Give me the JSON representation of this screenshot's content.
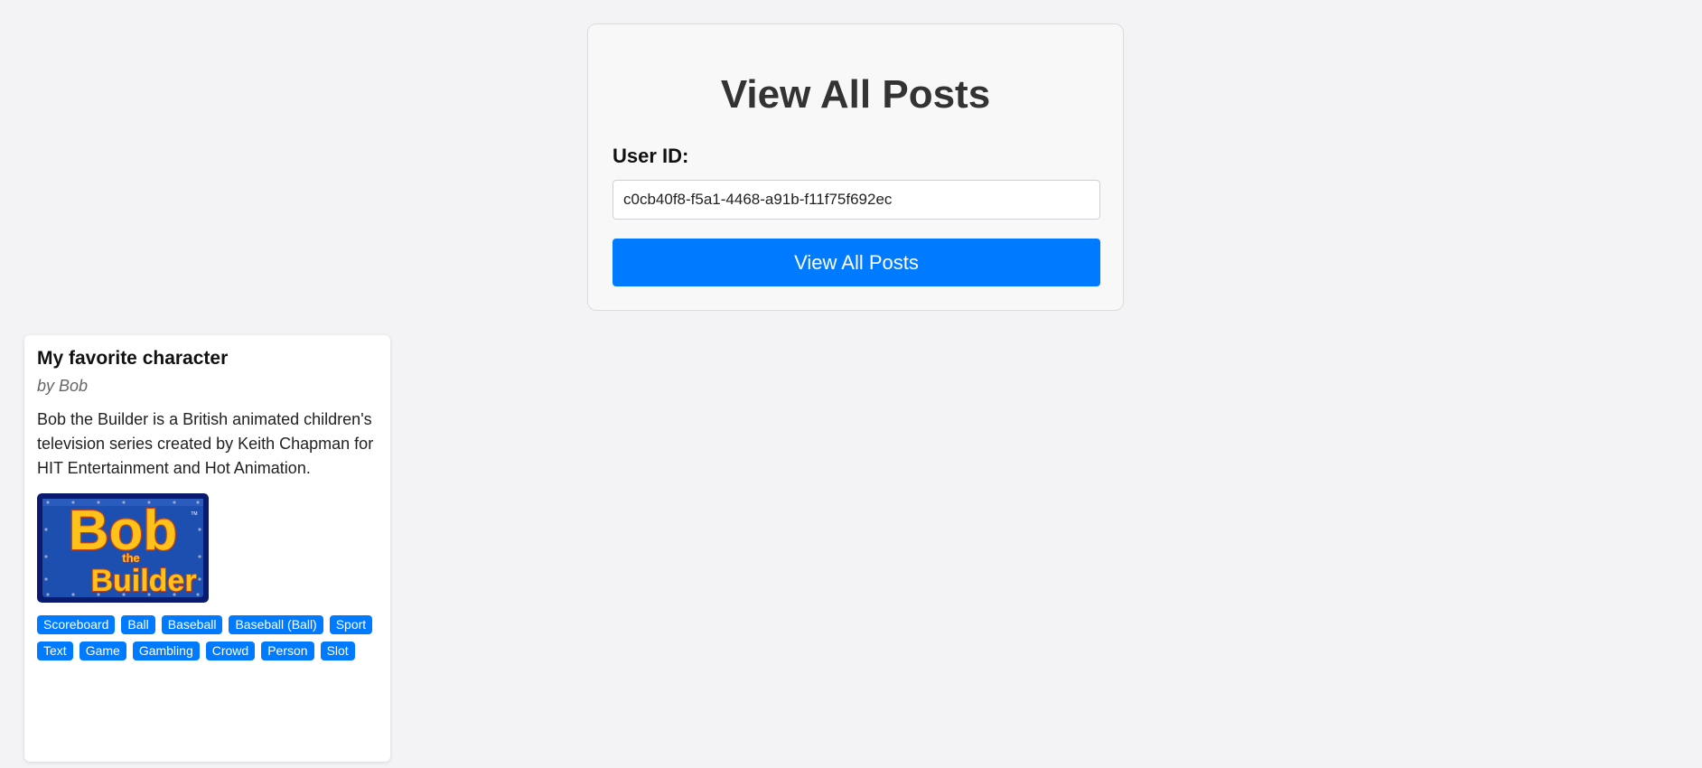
{
  "form": {
    "title": "View All Posts",
    "user_id_label": "User ID:",
    "user_id_value": "c0cb40f8-f5a1-4468-a91b-f11f75f692ec",
    "submit_label": "View All Posts"
  },
  "posts": [
    {
      "title": "My favorite character",
      "author": "by Bob",
      "body": "Bob the Builder is a British animated children's television series created by Keith Chapman for HIT Entertainment and Hot Animation.",
      "image": {
        "logo_word_1": "Bob",
        "logo_word_2": "the",
        "logo_word_3": "Builder",
        "logo_mark": "TM",
        "colors": {
          "background": "#0a1a6e",
          "panel": "#1d4fb0",
          "letters": "#ffc21a",
          "letter_outline": "#c8410b"
        }
      },
      "tags": [
        "Scoreboard",
        "Ball",
        "Baseball",
        "Baseball (Ball)",
        "Sport",
        "Text",
        "Game",
        "Gambling",
        "Crowd",
        "Person",
        "Slot"
      ]
    }
  ],
  "colors": {
    "page_background": "#f3f3f6",
    "primary": "#007bff",
    "title_text": "#333333"
  }
}
